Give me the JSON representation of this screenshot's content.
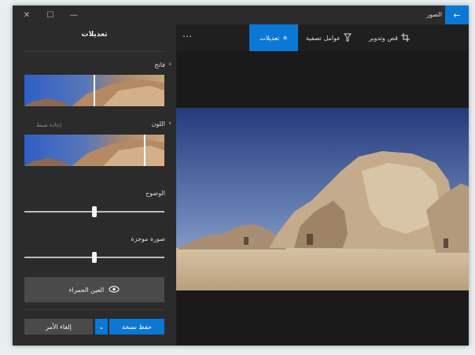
{
  "app": {
    "title": "الصور"
  },
  "window_controls": {
    "close_icon": "close-icon",
    "maximize_icon": "maximize-icon",
    "minimize_icon": "minimize-icon",
    "back_icon": "back-arrow-icon"
  },
  "toolbar": {
    "crop_label": "قص وتدوير",
    "filters_label": "عوامل تصفية",
    "adjust_label": "تعديلات",
    "more_label": "⋯"
  },
  "panel": {
    "title": "تعديلات",
    "light_label": "فاتح",
    "color_label": "اللون",
    "reset_label": "إعادة ضبط",
    "clarity_label": "الوضوح",
    "vignette_label": "صورة موجزة",
    "red_eye_label": "العين الحمراء",
    "save_copy_label": "حفظ نسخة",
    "cancel_label": "إلغاء الأمر"
  },
  "values": {
    "light": 0.5,
    "color": 0.86,
    "clarity": 0.5,
    "vignette": 0.5
  },
  "colors": {
    "accent": "#0a78d4",
    "panel": "#2b2b2b",
    "background": "#1f1f1f"
  }
}
